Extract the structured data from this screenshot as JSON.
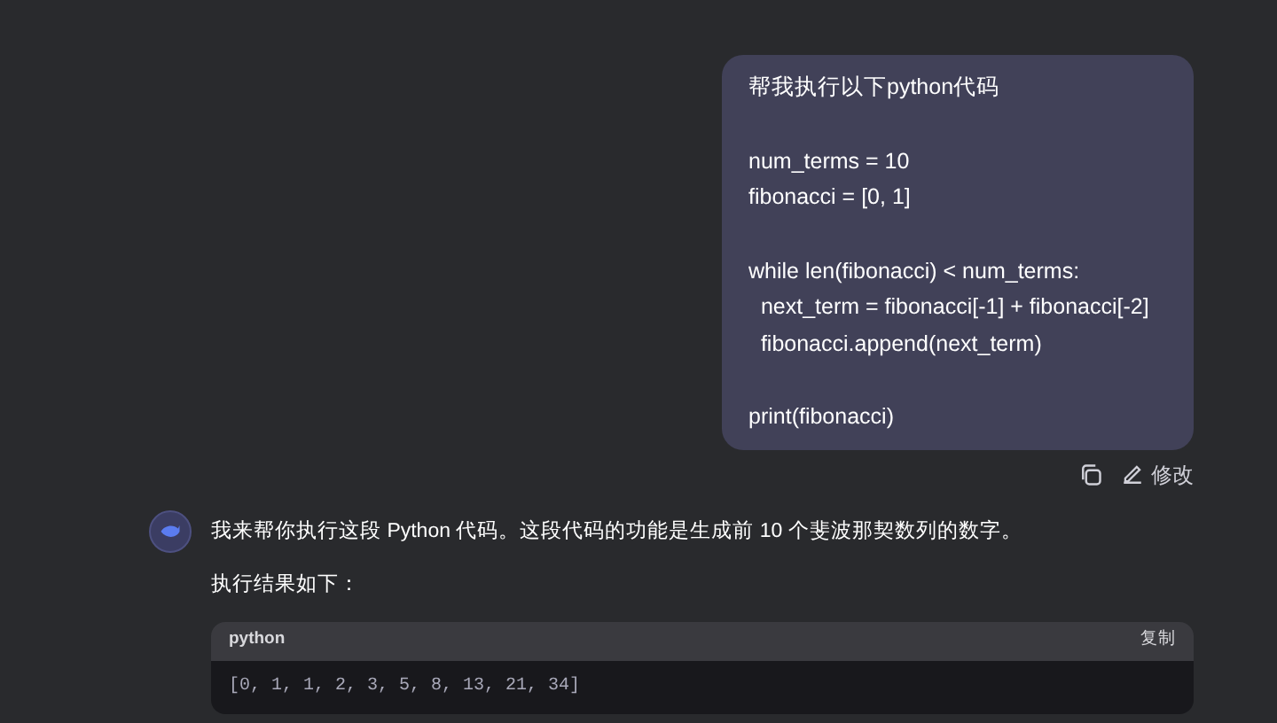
{
  "user_message": {
    "paragraphs": [
      [
        "帮我执行以下python代码"
      ],
      [
        "num_terms = 10",
        "fibonacci = [0, 1]"
      ],
      [
        "while len(fibonacci) < num_terms:",
        "  next_term = fibonacci[-1] + fibonacci[-2]",
        "  fibonacci.append(next_term)"
      ],
      [
        "print(fibonacci)"
      ]
    ],
    "actions": {
      "edit_label": "修改"
    }
  },
  "assistant_message": {
    "paragraphs": [
      "我来帮你执行这段 Python 代码。这段代码的功能是生成前 10 个斐波那契数列的数字。",
      "执行结果如下："
    ],
    "code_block": {
      "language": "python",
      "copy_label": "复制",
      "code": "[0, 1, 1, 2, 3, 5, 8, 13, 21, 34]"
    }
  }
}
